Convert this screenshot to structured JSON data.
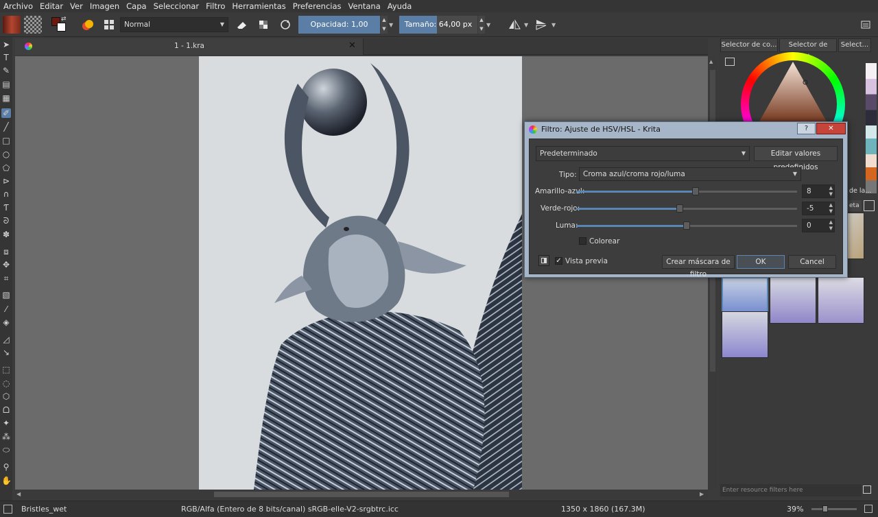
{
  "menu": [
    "Archivo",
    "Editar",
    "Ver",
    "Imagen",
    "Capa",
    "Seleccionar",
    "Filtro",
    "Herramientas",
    "Preferencias",
    "Ventana",
    "Ayuda"
  ],
  "toolbar": {
    "blend_mode": "Normal",
    "opacity_label": "Opacidad:",
    "opacity_value": "1,00",
    "size_label": "Tamaño:",
    "size_value": "64,00 px"
  },
  "document": {
    "tab_title": "1 - 1.kra"
  },
  "right_tabs": [
    "Selector de co...",
    "Selector de col...",
    "Select..."
  ],
  "right_panel": {
    "partial_label": "de la...",
    "partial_combo": "eta",
    "resource_filter_placeholder": "Enter resource filters here"
  },
  "dialog": {
    "title": "Filtro: Ajuste de HSV/HSL - Krita",
    "help_label": "?",
    "close_label": "✕",
    "preset_value": "Predeterminado",
    "edit_presets_label": "Editar valores predefinidos",
    "type_label": "Tipo:",
    "type_value": "Croma azul/croma rojo/luma",
    "sliders": [
      {
        "label": "Amarillo-azul:",
        "value": "8",
        "fraction": 0.54
      },
      {
        "label": "Verde-rojo:",
        "value": "-5",
        "fraction": 0.47
      },
      {
        "label": "Luma:",
        "value": "0",
        "fraction": 0.5
      }
    ],
    "colorize_label": "Colorear",
    "colorize_checked": false,
    "preview_label": "Vista previa",
    "preview_checked": true,
    "create_mask_label": "Crear máscara de filtro",
    "ok_label": "OK",
    "cancel_label": "Cancel"
  },
  "status": {
    "brush_preset": "Bristles_wet",
    "color_space": "RGB/Alfa (Entero de 8 bits/canal)  sRGB-elle-V2-srgbtrc.icc",
    "dimensions": "1350 x 1860 (167.3M)",
    "zoom": "39%"
  },
  "colors": {
    "accent": "#5a86b4",
    "dialog_frame": "#a6b6c8",
    "foreground": "#6b1a10",
    "background": "#ffffff"
  }
}
